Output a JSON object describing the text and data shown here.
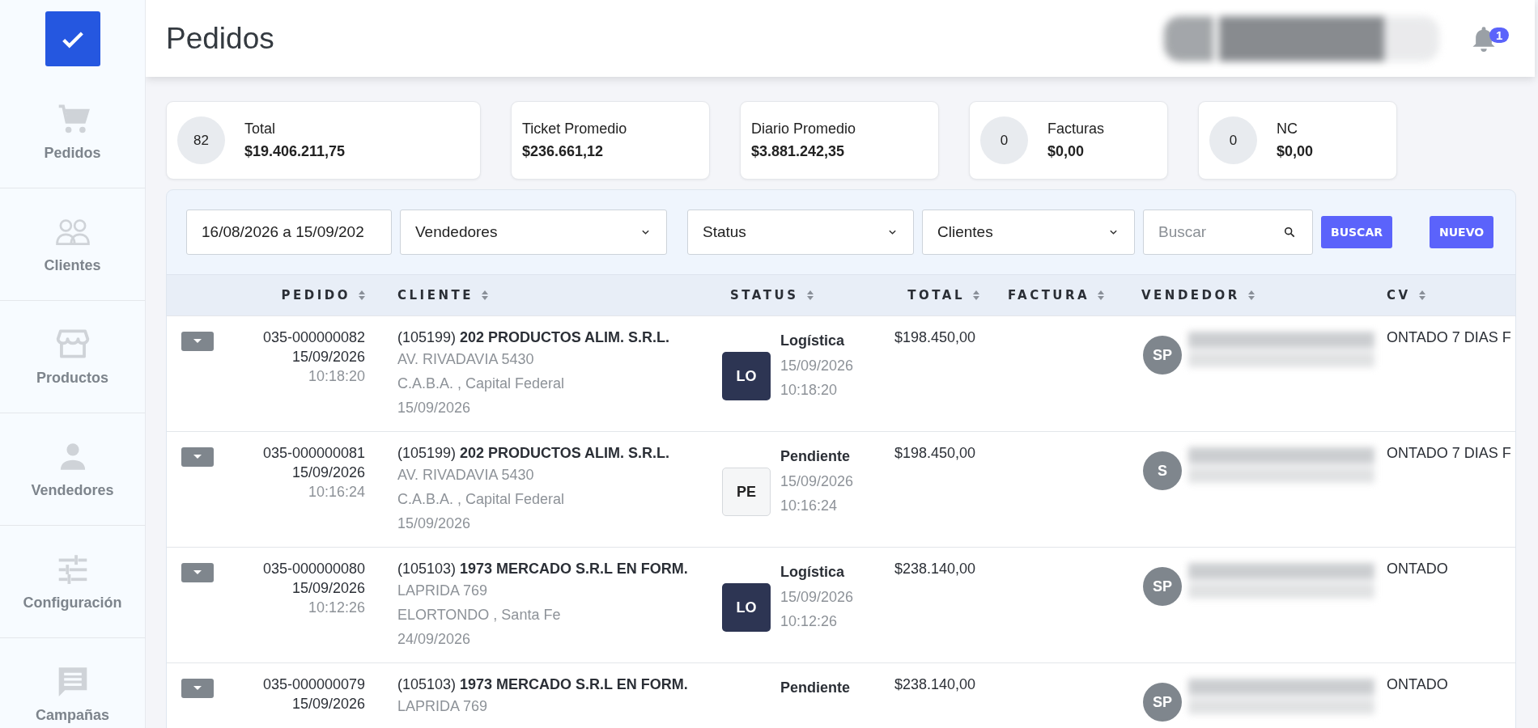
{
  "sidebar": {
    "items": [
      {
        "kind": "cart",
        "label": "Pedidos"
      },
      {
        "kind": "users",
        "label": "Clientes"
      },
      {
        "kind": "store",
        "label": "Productos"
      },
      {
        "kind": "person",
        "label": "Vendedores"
      },
      {
        "kind": "sliders",
        "label": "Configuración"
      },
      {
        "kind": "chat",
        "label": "Campañas"
      }
    ]
  },
  "header": {
    "title": "Pedidos",
    "notifications": "1"
  },
  "summary_cards": [
    {
      "count": "82",
      "label": "Total",
      "value": "$19.406.211,75"
    },
    {
      "label": "Ticket Promedio",
      "value": "$236.661,12"
    },
    {
      "label": "Diario Promedio",
      "value": "$3.881.242,35"
    },
    {
      "count": "0",
      "label": "Facturas",
      "value": "$0,00"
    },
    {
      "count": "0",
      "label": "NC",
      "value": "$0,00"
    }
  ],
  "filters": {
    "date_range": "16/08/2026 a 15/09/202",
    "selects": [
      "Vendedores",
      "Status",
      "Clientes"
    ],
    "search": {
      "placeholder": "Buscar"
    },
    "search_button": "BUSCAR",
    "new_button": "NUEVO"
  },
  "table": {
    "columns": [
      "PEDIDO",
      "CLIENTE",
      "STATUS",
      "TOTAL",
      "FACTURA",
      "VENDEDOR",
      "CV"
    ],
    "rows": [
      {
        "order": "035-000000082",
        "date": "15/09/2026",
        "time": "10:18:20",
        "client": "(105199) **202 PRODUCTOS ALIM. S.R.L.**",
        "address": "AV. RIVADAVIA 5430",
        "city": "C.A.B.A. , Capital Federal",
        "client_date": "15/09/2026",
        "status": {
          "kind": "filled",
          "code": "LO",
          "label": "Logística",
          "date": "15/09/2026",
          "time": "10:18:20"
        },
        "total": "$198.450,00",
        "vendor_initials": "SP",
        "cv": "ONTADO 7 DIAS F"
      },
      {
        "order": "035-000000081",
        "date": "15/09/2026",
        "time": "10:16:24",
        "client": "(105199) **202 PRODUCTOS ALIM. S.R.L.**",
        "address": "AV. RIVADAVIA 5430",
        "city": "C.A.B.A. , Capital Federal",
        "client_date": "15/09/2026",
        "status": {
          "kind": "outline",
          "code": "PE",
          "label": "Pendiente",
          "date": "15/09/2026",
          "time": "10:16:24"
        },
        "total": "$198.450,00",
        "vendor_initials": "S",
        "cv": "ONTADO 7 DIAS F"
      },
      {
        "order": "035-000000080",
        "date": "15/09/2026",
        "time": "10:12:26",
        "client": "(105103) **1973 MERCADO S.R.L EN FORM.**",
        "address": "LAPRIDA 769",
        "city": "ELORTONDO , Santa Fe",
        "client_date": "24/09/2026",
        "status": {
          "kind": "filled",
          "code": "LO",
          "label": "Logística",
          "date": "15/09/2026",
          "time": "10:12:26"
        },
        "total": "$238.140,00",
        "vendor_initials": "SP",
        "cv": "ONTADO"
      },
      {
        "order": "035-000000079",
        "date": "15/09/2026",
        "client": "(105103) **1973 MERCADO S.R.L EN FORM.**",
        "address": "LAPRIDA 769",
        "status": {
          "label": "Pendiente"
        },
        "total": "$238.140,00",
        "vendor_initials": "SP",
        "cv": "ONTADO"
      }
    ]
  }
}
